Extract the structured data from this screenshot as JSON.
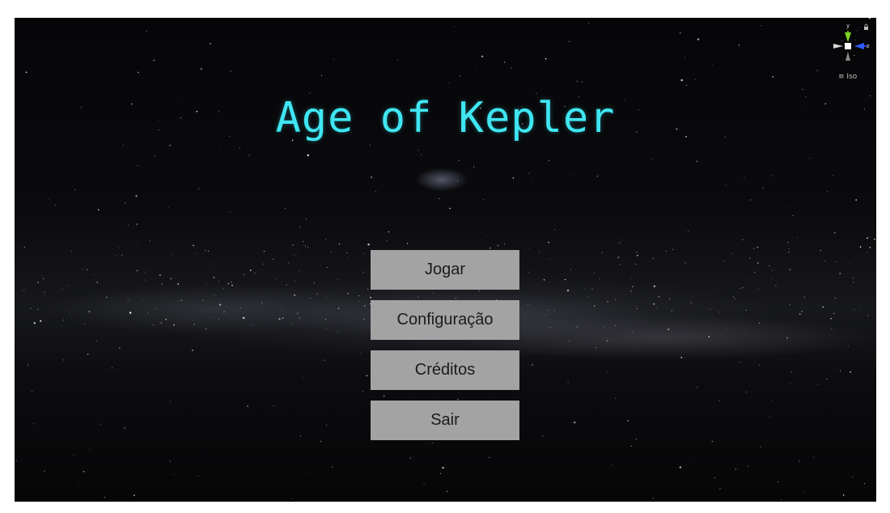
{
  "game": {
    "title": "Age of Kepler",
    "menu": {
      "items": [
        {
          "label": "Jogar"
        },
        {
          "label": "Configuração"
        },
        {
          "label": "Créditos"
        },
        {
          "label": "Sair"
        }
      ],
      "button_color": "#a3a3a3"
    },
    "title_color": "#3fe6f2"
  },
  "gizmo": {
    "axis_y": "y",
    "axis_z": "z",
    "projection": "Iso",
    "icons": [
      "lock-icon",
      "menu-lines-icon"
    ],
    "colors": {
      "y": "#7ed321",
      "z": "#2f5bff",
      "x": "#cfcfcf"
    }
  }
}
